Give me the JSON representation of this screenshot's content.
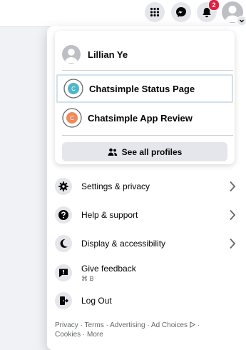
{
  "topbar": {
    "notifications_count": "2"
  },
  "account": {
    "name": "Lillian Ye"
  },
  "profiles": [
    {
      "name": "Chatsimple Status Page",
      "initial": "C",
      "color": "#4fb6c9"
    },
    {
      "name": "Chatsimple App Review",
      "initial": "C",
      "color": "#ee8a5a"
    }
  ],
  "see_all_label": "See all profiles",
  "menu_items": [
    {
      "label": "Settings & privacy",
      "icon": "gear-icon"
    },
    {
      "label": "Help & support",
      "icon": "question-icon"
    },
    {
      "label": "Display & accessibility",
      "icon": "moon-icon"
    },
    {
      "label": "Give feedback",
      "sub": "⌘ B",
      "icon": "feedback-icon"
    },
    {
      "label": "Log Out",
      "icon": "logout-icon"
    }
  ],
  "footer": {
    "privacy": "Privacy",
    "terms": "Terms",
    "advertising": "Advertising",
    "ad_choices": "Ad Choices",
    "cookies": "Cookies",
    "more": "More"
  },
  "colors": {
    "notification_badge": "#e41e3f",
    "highlight_border": "#cfe1f0"
  }
}
